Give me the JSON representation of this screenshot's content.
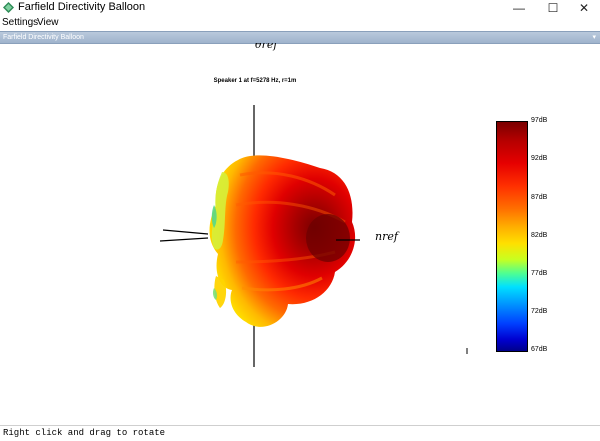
{
  "window": {
    "title": "Farfield Directivity Balloon",
    "controls": {
      "minimize": "—",
      "maximize": "☐",
      "close": "✕"
    }
  },
  "menu": {
    "items": [
      "Settings",
      "View"
    ]
  },
  "panel": {
    "title": "Farfield Directivity Balloon",
    "arrow": "▾"
  },
  "plot": {
    "title": "Speaker 1 at f=5278 Hz, r=1m",
    "axis_labels": {
      "top": "θref",
      "right": "nref"
    }
  },
  "colorbar": {
    "labels": [
      "97dB",
      "92dB",
      "87dB",
      "82dB",
      "77dB",
      "72dB",
      "67dB"
    ]
  },
  "status": {
    "text": "Right click and drag to rotate"
  },
  "colors": {
    "panel_bar": "#a9bcd3",
    "hot": "#8b0000",
    "warm": "#ff2a00",
    "mid": "#ffd000"
  }
}
